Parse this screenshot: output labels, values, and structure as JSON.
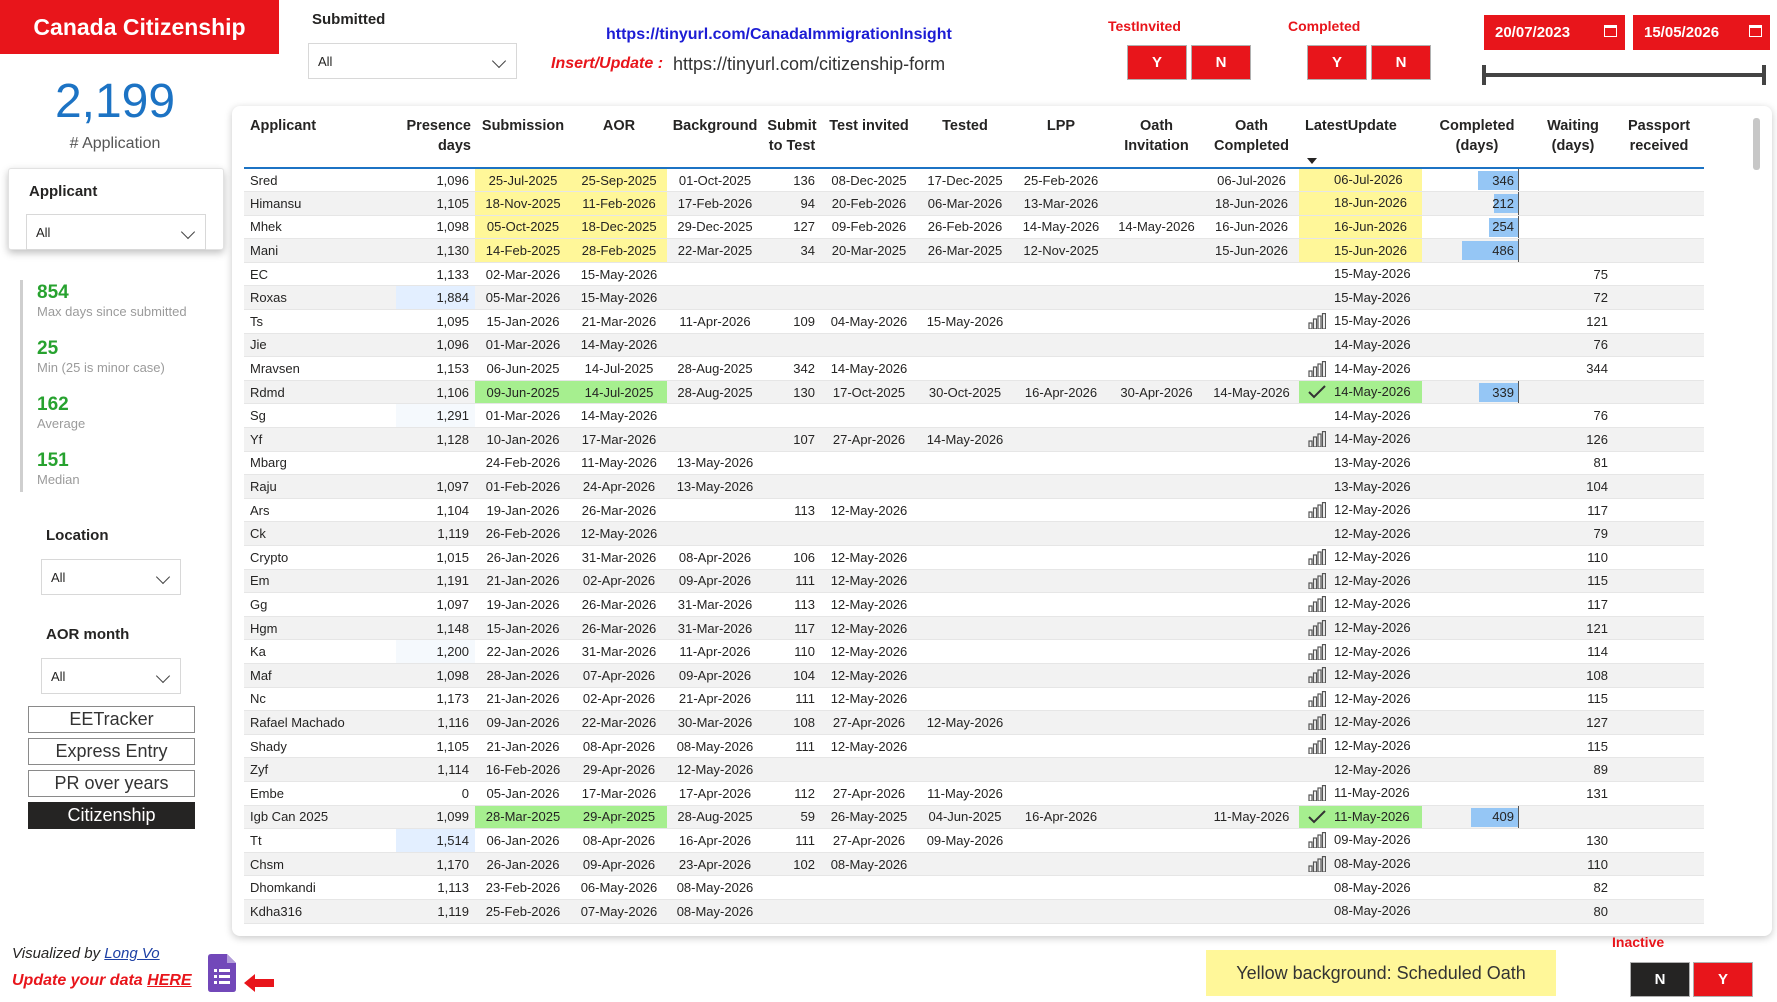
{
  "header": {
    "title": "Canada Citizenship",
    "url_main": "https://tinyurl.com/CanadaImmigrationInsight",
    "insert_update_label": "Insert/Update :",
    "insert_update_url": "https://tinyurl.com/citizenship-form"
  },
  "kpi": {
    "value": "2,199",
    "label": "# Application"
  },
  "slicers": {
    "submitted": {
      "label": "Submitted",
      "value": "All"
    },
    "applicant": {
      "label": "Applicant",
      "value": "All"
    },
    "location": {
      "label": "Location",
      "value": "All"
    },
    "aor_month": {
      "label": "AOR month",
      "value": "All"
    }
  },
  "stats": [
    {
      "value": "854",
      "label": "Max days since submitted"
    },
    {
      "value": "25",
      "label": "Min (25 is minor case)"
    },
    {
      "value": "162",
      "label": "Average"
    },
    {
      "value": "151",
      "label": "Median"
    }
  ],
  "nav": [
    "EETracker",
    "Express Entry",
    "PR over years",
    "Citizenship"
  ],
  "toggles": {
    "test_invited": {
      "label": "TestInvited",
      "yes": "Y",
      "no": "N"
    },
    "completed": {
      "label": "Completed",
      "yes": "Y",
      "no": "N"
    },
    "inactive": {
      "label": "Inactive",
      "no": "N",
      "yes": "Y"
    }
  },
  "date_range": {
    "start": "20/07/2023",
    "end": "15/05/2026"
  },
  "table": {
    "columns": [
      "Applicant",
      "Presence days",
      "Submission",
      "AOR",
      "Background",
      "Submit to Test",
      "Test invited",
      "Tested",
      "LPP",
      "Oath Invitation",
      "Oath Completed",
      "LatestUpdate",
      "Completed (days)",
      "Waiting (days)",
      "Passport received"
    ],
    "rows": [
      {
        "name": "Sred",
        "presence": "1,096",
        "submission": "25-Jul-2025",
        "aor": "25-Sep-2025",
        "background": "01-Oct-2025",
        "submit_test": "136",
        "test_invited": "08-Dec-2025",
        "tested": "17-Dec-2025",
        "lpp": "25-Feb-2026",
        "oath_inv": "",
        "oath_comp": "06-Jul-2026",
        "latest": "06-Jul-2026",
        "completed": "346",
        "waiting": "",
        "passport": "",
        "hl": "yellow",
        "icon": ""
      },
      {
        "name": "Himansu",
        "presence": "1,105",
        "submission": "18-Nov-2025",
        "aor": "11-Feb-2026",
        "background": "17-Feb-2026",
        "submit_test": "94",
        "test_invited": "20-Feb-2026",
        "tested": "06-Mar-2026",
        "lpp": "13-Mar-2026",
        "oath_inv": "",
        "oath_comp": "18-Jun-2026",
        "latest": "18-Jun-2026",
        "completed": "212",
        "waiting": "",
        "passport": "",
        "hl": "yellow",
        "icon": ""
      },
      {
        "name": "Mhek",
        "presence": "1,098",
        "submission": "05-Oct-2025",
        "aor": "18-Dec-2025",
        "background": "29-Dec-2025",
        "submit_test": "127",
        "test_invited": "09-Feb-2026",
        "tested": "26-Feb-2026",
        "lpp": "14-May-2026",
        "oath_inv": "14-May-2026",
        "oath_comp": "16-Jun-2026",
        "latest": "16-Jun-2026",
        "completed": "254",
        "waiting": "",
        "passport": "",
        "hl": "yellow",
        "icon": ""
      },
      {
        "name": "Mani",
        "presence": "1,130",
        "submission": "14-Feb-2025",
        "aor": "28-Feb-2025",
        "background": "22-Mar-2025",
        "submit_test": "34",
        "test_invited": "20-Mar-2025",
        "tested": "26-Mar-2025",
        "lpp": "12-Nov-2025",
        "oath_inv": "",
        "oath_comp": "15-Jun-2026",
        "latest": "15-Jun-2026",
        "completed": "486",
        "waiting": "",
        "passport": "",
        "hl": "yellow",
        "icon": ""
      },
      {
        "name": "EC",
        "presence": "1,133",
        "submission": "02-Mar-2026",
        "aor": "15-May-2026",
        "background": "",
        "submit_test": "",
        "test_invited": "",
        "tested": "",
        "lpp": "",
        "oath_inv": "",
        "oath_comp": "",
        "latest": "15-May-2026",
        "completed": "",
        "waiting": "75",
        "passport": "",
        "hl": "",
        "icon": ""
      },
      {
        "name": "Roxas",
        "presence": "1,884",
        "submission": "05-Mar-2026",
        "aor": "15-May-2026",
        "background": "",
        "submit_test": "",
        "test_invited": "",
        "tested": "",
        "lpp": "",
        "oath_inv": "",
        "oath_comp": "",
        "latest": "15-May-2026",
        "completed": "",
        "waiting": "72",
        "passport": "",
        "hl": "",
        "icon": ""
      },
      {
        "name": "Ts",
        "presence": "1,095",
        "submission": "15-Jan-2026",
        "aor": "21-Mar-2026",
        "background": "11-Apr-2026",
        "submit_test": "109",
        "test_invited": "04-May-2026",
        "tested": "15-May-2026",
        "lpp": "",
        "oath_inv": "",
        "oath_comp": "",
        "latest": "15-May-2026",
        "completed": "",
        "waiting": "121",
        "passport": "",
        "hl": "",
        "icon": "bar"
      },
      {
        "name": "Jie",
        "presence": "1,096",
        "submission": "01-Mar-2026",
        "aor": "14-May-2026",
        "background": "",
        "submit_test": "",
        "test_invited": "",
        "tested": "",
        "lpp": "",
        "oath_inv": "",
        "oath_comp": "",
        "latest": "14-May-2026",
        "completed": "",
        "waiting": "76",
        "passport": "",
        "hl": "",
        "icon": ""
      },
      {
        "name": "Mravsen",
        "presence": "1,153",
        "submission": "06-Jun-2025",
        "aor": "14-Jul-2025",
        "background": "28-Aug-2025",
        "submit_test": "342",
        "test_invited": "14-May-2026",
        "tested": "",
        "lpp": "",
        "oath_inv": "",
        "oath_comp": "",
        "latest": "14-May-2026",
        "completed": "",
        "waiting": "344",
        "passport": "",
        "hl": "",
        "icon": "bar"
      },
      {
        "name": "Rdmd",
        "presence": "1,106",
        "submission": "09-Jun-2025",
        "aor": "14-Jul-2025",
        "background": "28-Aug-2025",
        "submit_test": "130",
        "test_invited": "17-Oct-2025",
        "tested": "30-Oct-2025",
        "lpp": "16-Apr-2026",
        "oath_inv": "30-Apr-2026",
        "oath_comp": "14-May-2026",
        "latest": "14-May-2026",
        "completed": "339",
        "waiting": "",
        "passport": "",
        "hl": "green",
        "icon": "check"
      },
      {
        "name": "Sg",
        "presence": "1,291",
        "submission": "01-Mar-2026",
        "aor": "14-May-2026",
        "background": "",
        "submit_test": "",
        "test_invited": "",
        "tested": "",
        "lpp": "",
        "oath_inv": "",
        "oath_comp": "",
        "latest": "14-May-2026",
        "completed": "",
        "waiting": "76",
        "passport": "",
        "hl": "",
        "icon": ""
      },
      {
        "name": "Yf",
        "presence": "1,128",
        "submission": "10-Jan-2026",
        "aor": "17-Mar-2026",
        "background": "",
        "submit_test": "107",
        "test_invited": "27-Apr-2026",
        "tested": "14-May-2026",
        "lpp": "",
        "oath_inv": "",
        "oath_comp": "",
        "latest": "14-May-2026",
        "completed": "",
        "waiting": "126",
        "passport": "",
        "hl": "",
        "icon": "bar"
      },
      {
        "name": "Mbarg",
        "presence": "",
        "submission": "24-Feb-2026",
        "aor": "11-May-2026",
        "background": "13-May-2026",
        "submit_test": "",
        "test_invited": "",
        "tested": "",
        "lpp": "",
        "oath_inv": "",
        "oath_comp": "",
        "latest": "13-May-2026",
        "completed": "",
        "waiting": "81",
        "passport": "",
        "hl": "",
        "icon": ""
      },
      {
        "name": "Raju",
        "presence": "1,097",
        "submission": "01-Feb-2026",
        "aor": "24-Apr-2026",
        "background": "13-May-2026",
        "submit_test": "",
        "test_invited": "",
        "tested": "",
        "lpp": "",
        "oath_inv": "",
        "oath_comp": "",
        "latest": "13-May-2026",
        "completed": "",
        "waiting": "104",
        "passport": "",
        "hl": "",
        "icon": ""
      },
      {
        "name": "Ars",
        "presence": "1,104",
        "submission": "19-Jan-2026",
        "aor": "26-Mar-2026",
        "background": "",
        "submit_test": "113",
        "test_invited": "12-May-2026",
        "tested": "",
        "lpp": "",
        "oath_inv": "",
        "oath_comp": "",
        "latest": "12-May-2026",
        "completed": "",
        "waiting": "117",
        "passport": "",
        "hl": "",
        "icon": "bar"
      },
      {
        "name": "Ck",
        "presence": "1,119",
        "submission": "26-Feb-2026",
        "aor": "12-May-2026",
        "background": "",
        "submit_test": "",
        "test_invited": "",
        "tested": "",
        "lpp": "",
        "oath_inv": "",
        "oath_comp": "",
        "latest": "12-May-2026",
        "completed": "",
        "waiting": "79",
        "passport": "",
        "hl": "",
        "icon": ""
      },
      {
        "name": "Crypto",
        "presence": "1,015",
        "submission": "26-Jan-2026",
        "aor": "31-Mar-2026",
        "background": "08-Apr-2026",
        "submit_test": "106",
        "test_invited": "12-May-2026",
        "tested": "",
        "lpp": "",
        "oath_inv": "",
        "oath_comp": "",
        "latest": "12-May-2026",
        "completed": "",
        "waiting": "110",
        "passport": "",
        "hl": "",
        "icon": "bar"
      },
      {
        "name": "Em",
        "presence": "1,191",
        "submission": "21-Jan-2026",
        "aor": "02-Apr-2026",
        "background": "09-Apr-2026",
        "submit_test": "111",
        "test_invited": "12-May-2026",
        "tested": "",
        "lpp": "",
        "oath_inv": "",
        "oath_comp": "",
        "latest": "12-May-2026",
        "completed": "",
        "waiting": "115",
        "passport": "",
        "hl": "",
        "icon": "bar"
      },
      {
        "name": "Gg",
        "presence": "1,097",
        "submission": "19-Jan-2026",
        "aor": "26-Mar-2026",
        "background": "31-Mar-2026",
        "submit_test": "113",
        "test_invited": "12-May-2026",
        "tested": "",
        "lpp": "",
        "oath_inv": "",
        "oath_comp": "",
        "latest": "12-May-2026",
        "completed": "",
        "waiting": "117",
        "passport": "",
        "hl": "",
        "icon": "bar"
      },
      {
        "name": "Hgm",
        "presence": "1,148",
        "submission": "15-Jan-2026",
        "aor": "26-Mar-2026",
        "background": "31-Mar-2026",
        "submit_test": "117",
        "test_invited": "12-May-2026",
        "tested": "",
        "lpp": "",
        "oath_inv": "",
        "oath_comp": "",
        "latest": "12-May-2026",
        "completed": "",
        "waiting": "121",
        "passport": "",
        "hl": "",
        "icon": "bar"
      },
      {
        "name": "Ka",
        "presence": "1,200",
        "submission": "22-Jan-2026",
        "aor": "31-Mar-2026",
        "background": "11-Apr-2026",
        "submit_test": "110",
        "test_invited": "12-May-2026",
        "tested": "",
        "lpp": "",
        "oath_inv": "",
        "oath_comp": "",
        "latest": "12-May-2026",
        "completed": "",
        "waiting": "114",
        "passport": "",
        "hl": "",
        "icon": "bar"
      },
      {
        "name": "Maf",
        "presence": "1,098",
        "submission": "28-Jan-2026",
        "aor": "07-Apr-2026",
        "background": "09-Apr-2026",
        "submit_test": "104",
        "test_invited": "12-May-2026",
        "tested": "",
        "lpp": "",
        "oath_inv": "",
        "oath_comp": "",
        "latest": "12-May-2026",
        "completed": "",
        "waiting": "108",
        "passport": "",
        "hl": "",
        "icon": "bar"
      },
      {
        "name": "Nc",
        "presence": "1,173",
        "submission": "21-Jan-2026",
        "aor": "02-Apr-2026",
        "background": "21-Apr-2026",
        "submit_test": "111",
        "test_invited": "12-May-2026",
        "tested": "",
        "lpp": "",
        "oath_inv": "",
        "oath_comp": "",
        "latest": "12-May-2026",
        "completed": "",
        "waiting": "115",
        "passport": "",
        "hl": "",
        "icon": "bar"
      },
      {
        "name": "Rafael Machado",
        "presence": "1,116",
        "submission": "09-Jan-2026",
        "aor": "22-Mar-2026",
        "background": "30-Mar-2026",
        "submit_test": "108",
        "test_invited": "27-Apr-2026",
        "tested": "12-May-2026",
        "lpp": "",
        "oath_inv": "",
        "oath_comp": "",
        "latest": "12-May-2026",
        "completed": "",
        "waiting": "127",
        "passport": "",
        "hl": "",
        "icon": "bar"
      },
      {
        "name": "Shady",
        "presence": "1,105",
        "submission": "21-Jan-2026",
        "aor": "08-Apr-2026",
        "background": "08-May-2026",
        "submit_test": "111",
        "test_invited": "12-May-2026",
        "tested": "",
        "lpp": "",
        "oath_inv": "",
        "oath_comp": "",
        "latest": "12-May-2026",
        "completed": "",
        "waiting": "115",
        "passport": "",
        "hl": "",
        "icon": "bar"
      },
      {
        "name": "Zyf",
        "presence": "1,114",
        "submission": "16-Feb-2026",
        "aor": "29-Apr-2026",
        "background": "12-May-2026",
        "submit_test": "",
        "test_invited": "",
        "tested": "",
        "lpp": "",
        "oath_inv": "",
        "oath_comp": "",
        "latest": "12-May-2026",
        "completed": "",
        "waiting": "89",
        "passport": "",
        "hl": "",
        "icon": ""
      },
      {
        "name": "Embe",
        "presence": "0",
        "submission": "05-Jan-2026",
        "aor": "17-Mar-2026",
        "background": "17-Apr-2026",
        "submit_test": "112",
        "test_invited": "27-Apr-2026",
        "tested": "11-May-2026",
        "lpp": "",
        "oath_inv": "",
        "oath_comp": "",
        "latest": "11-May-2026",
        "completed": "",
        "waiting": "131",
        "passport": "",
        "hl": "",
        "icon": "bar"
      },
      {
        "name": "Igb Can 2025",
        "presence": "1,099",
        "submission": "28-Mar-2025",
        "aor": "29-Apr-2025",
        "background": "28-Aug-2025",
        "submit_test": "59",
        "test_invited": "26-May-2025",
        "tested": "04-Jun-2025",
        "lpp": "16-Apr-2026",
        "oath_inv": "",
        "oath_comp": "11-May-2026",
        "latest": "11-May-2026",
        "completed": "409",
        "waiting": "",
        "passport": "",
        "hl": "green",
        "icon": "check"
      },
      {
        "name": "Tt",
        "presence": "1,514",
        "submission": "06-Jan-2026",
        "aor": "08-Apr-2026",
        "background": "16-Apr-2026",
        "submit_test": "111",
        "test_invited": "27-Apr-2026",
        "tested": "09-May-2026",
        "lpp": "",
        "oath_inv": "",
        "oath_comp": "",
        "latest": "09-May-2026",
        "completed": "",
        "waiting": "130",
        "passport": "",
        "hl": "",
        "icon": "bar"
      },
      {
        "name": "Chsm",
        "presence": "1,170",
        "submission": "26-Jan-2026",
        "aor": "09-Apr-2026",
        "background": "23-Apr-2026",
        "submit_test": "102",
        "test_invited": "08-May-2026",
        "tested": "",
        "lpp": "",
        "oath_inv": "",
        "oath_comp": "",
        "latest": "08-May-2026",
        "completed": "",
        "waiting": "110",
        "passport": "",
        "hl": "",
        "icon": "bar"
      },
      {
        "name": "Dhomkandi",
        "presence": "1,113",
        "submission": "23-Feb-2026",
        "aor": "06-May-2026",
        "background": "08-May-2026",
        "submit_test": "",
        "test_invited": "",
        "tested": "",
        "lpp": "",
        "oath_inv": "",
        "oath_comp": "",
        "latest": "08-May-2026",
        "completed": "",
        "waiting": "82",
        "passport": "",
        "hl": "",
        "icon": ""
      },
      {
        "name": "Kdha316",
        "presence": "1,119",
        "submission": "25-Feb-2026",
        "aor": "07-May-2026",
        "background": "08-May-2026",
        "submit_test": "",
        "test_invited": "",
        "tested": "",
        "lpp": "",
        "oath_inv": "",
        "oath_comp": "",
        "latest": "08-May-2026",
        "completed": "",
        "waiting": "80",
        "passport": "",
        "hl": "",
        "icon": ""
      }
    ]
  },
  "footer": {
    "visualized_by": "Visualized by",
    "author": "Long Vo",
    "update_prefix": "Update your data",
    "update_link": "HERE",
    "legend_text": "Yellow background: Scheduled Oath"
  },
  "colors": {
    "brand_red": "#e8151b",
    "kpi_blue": "#1c73c4",
    "stat_green": "#27a22f",
    "oath_yellow": "#fff799",
    "done_green": "#a6ef8f",
    "bar_blue": "#95c6f5"
  },
  "icons": {
    "form": "google-forms-icon",
    "arrow": "left-arrow-icon",
    "calendar": "calendar-icon"
  }
}
